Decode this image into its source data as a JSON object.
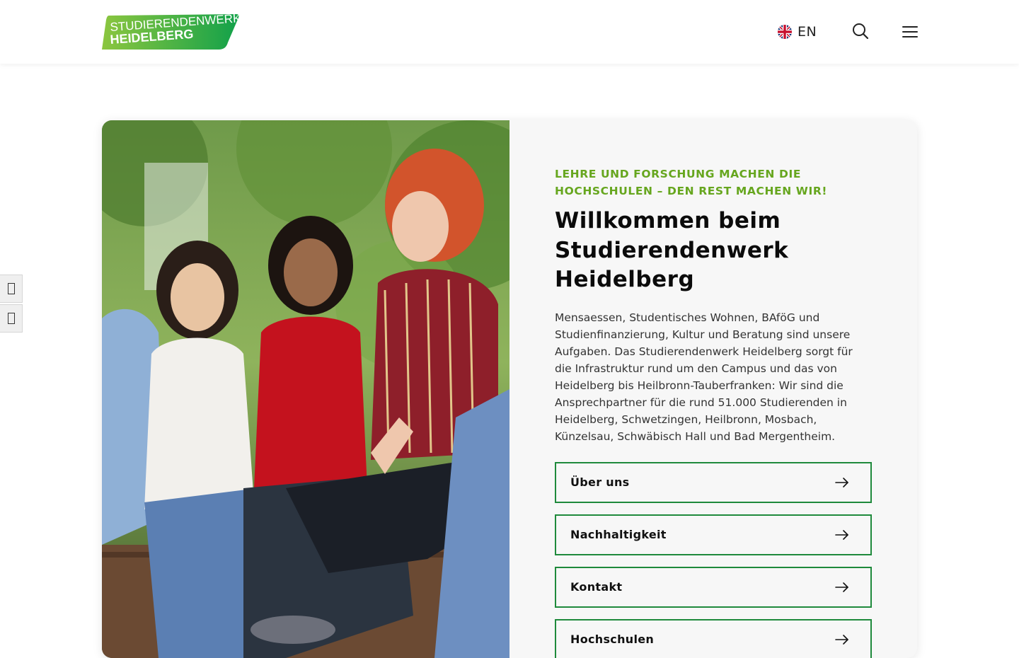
{
  "header": {
    "logo": {
      "line1": "STUDIERENDENWERK",
      "line2": "HEIDELBERG",
      "registered": "®"
    },
    "language": {
      "label": "EN",
      "icon": "uk-flag-icon"
    },
    "search_icon": "search-icon",
    "menu_icon": "hamburger-menu-icon"
  },
  "hero": {
    "kicker": "LEHRE UND FORSCHUNG MACHEN DIE HOCHSCHULEN – DEN REST MACHEN WIR!",
    "title": "Willkommen beim Studierendenwerk Heidelberg",
    "description": "Mensaessen, Studentisches Wohnen, BAföG und Studienfinanzierung, Kultur und Beratung sind unsere Aufgaben. Das Studierendenwerk Heidelberg sorgt für die Infrastruktur rund um den Campus und das von Heidelberg bis Heilbronn-Tauberfranken: Wir sind die Ansprechpartner für die rund 51.000 Studierenden in Heidelberg, Schwetzingen, Heilbronn, Mosbach, Künzelsau, Schwäbisch Hall und Bad Mergentheim.",
    "links": [
      {
        "label": "Über uns",
        "icon": "arrow-right-icon"
      },
      {
        "label": "Nachhaltigkeit",
        "icon": "arrow-right-icon"
      },
      {
        "label": "Kontakt",
        "icon": "arrow-right-icon"
      },
      {
        "label": "Hochschulen",
        "icon": "arrow-right-icon"
      }
    ]
  },
  "side_tools": [
    {
      "icon": "accessibility-tool-icon"
    },
    {
      "icon": "accessibility-tool-icon"
    }
  ],
  "colors": {
    "brand_green": "#1f8a3c",
    "kicker_green": "#66a61e",
    "logo_green": "#2db04a",
    "card_bg": "#f7f7f7"
  }
}
